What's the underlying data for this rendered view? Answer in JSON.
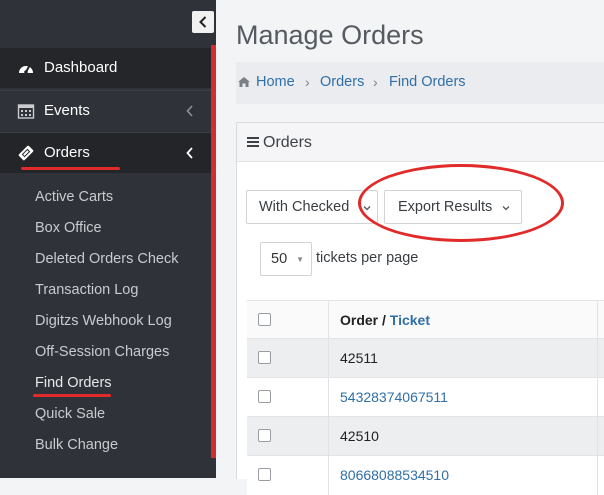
{
  "sidebar": {
    "nav": [
      {
        "label": "Dashboard",
        "icon": "dashboard-icon"
      },
      {
        "label": "Events",
        "icon": "calendar-icon"
      },
      {
        "label": "Orders",
        "icon": "ticket-icon"
      }
    ],
    "orders_sub": [
      "Active Carts",
      "Box Office",
      "Deleted Orders Check",
      "Transaction Log",
      "Digitzs Webhook Log",
      "Off-Session Charges",
      "Find Orders",
      "Quick Sale",
      "Bulk Change"
    ]
  },
  "page": {
    "title": "Manage Orders",
    "breadcrumb": [
      "Home",
      "Orders",
      "Find Orders"
    ]
  },
  "panel": {
    "title": "Orders",
    "with_checked_label": "With Checked",
    "export_label": "Export Results",
    "page_size_value": "50",
    "page_size_suffix": "tickets per page"
  },
  "table": {
    "header_order": "Order",
    "header_sep": " / ",
    "header_ticket": "Ticket",
    "rows": [
      "42511",
      "54328374067511",
      "42510",
      "80668088534510"
    ]
  },
  "colors": {
    "sidebar_bg": "#2f3238",
    "accent_red": "#d12f2f",
    "link_blue": "#2f6fa8"
  }
}
